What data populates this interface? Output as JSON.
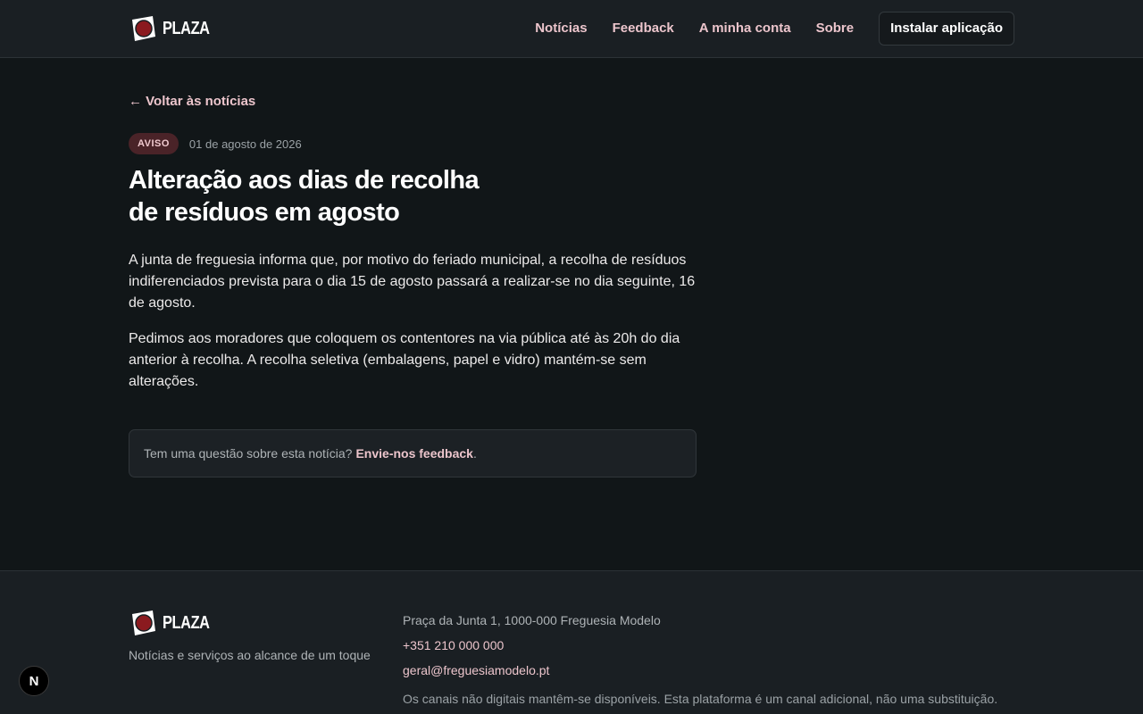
{
  "brand": {
    "name": "PLAZA",
    "accent": "#ecc5cc",
    "logo_red": "#8b1a1f"
  },
  "nav": {
    "links": [
      "Notícias",
      "Feedback",
      "A minha conta",
      "Sobre"
    ],
    "install_label": "Instalar aplicação"
  },
  "article": {
    "back_label": "← Voltar às notícias",
    "badge": "AVISO",
    "date": "01 de agosto de 2026",
    "title_line1": "Alteração aos dias de recolha",
    "title_line2": "de resíduos em agosto",
    "paragraphs": [
      "A junta de freguesia informa que, por motivo do feriado municipal, a recolha de resíduos indiferenciados prevista para o dia 15 de agosto passará a realizar-se no dia seguinte, 16 de agosto.",
      "Pedimos aos moradores que coloquem os contentores na via pública até às 20h do dia anterior à recolha. A recolha seletiva (embalagens, papel e vidro) mantém-se sem alterações."
    ],
    "feedback_prompt": "Tem uma questão sobre esta notícia?",
    "feedback_link": "Envie-nos feedback",
    "feedback_end": "."
  },
  "footer": {
    "tagline": "Notícias e serviços ao alcance de um toque",
    "address": "Praça da Junta 1, 1000-000 Freguesia Modelo",
    "phone": "+351 210 000 000",
    "email": "geral@freguesiamodelo.pt",
    "notice": "Os canais não digitais mantêm-se disponíveis. Esta plataforma é um canal adicional, não uma substituição."
  },
  "dev_badge": "N"
}
